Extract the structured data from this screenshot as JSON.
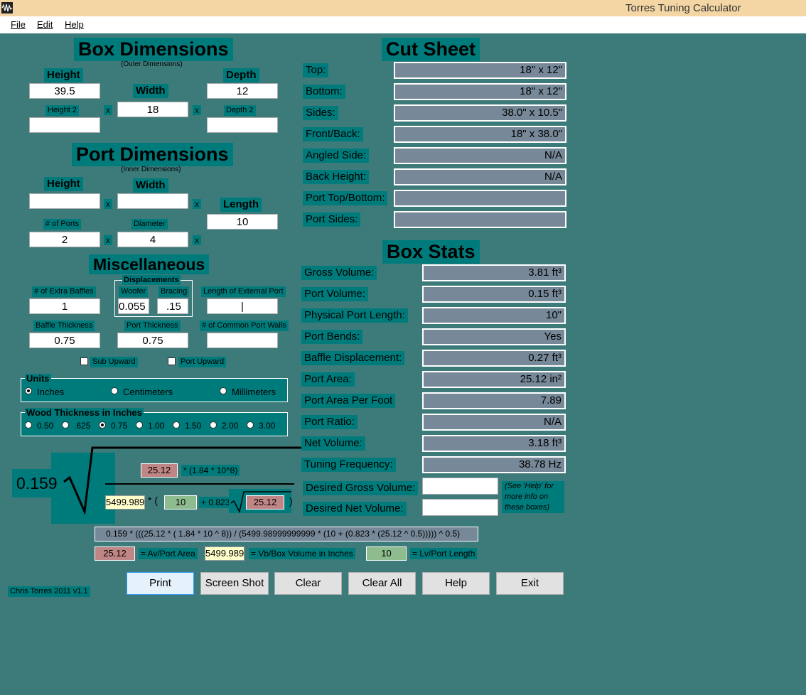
{
  "window": {
    "title": "Torres Tuning Calculator"
  },
  "menu": {
    "file": "File",
    "edit": "Edit",
    "help": "Help"
  },
  "box": {
    "title": "Box Dimensions",
    "subtitle": "(Outer Dimensions)",
    "height_label": "Height",
    "height_value": "39.5",
    "width_label": "Width",
    "width_value": "18",
    "depth_label": "Depth",
    "depth_value": "12",
    "height2_label": "Height 2",
    "height2_value": "",
    "depth2_label": "Depth 2",
    "depth2_value": ""
  },
  "port": {
    "title": "Port Dimensions",
    "subtitle": "(Inner Dimensions)",
    "height_label": "Height",
    "height_value": "",
    "width_label": "Width",
    "width_value": "",
    "length_label": "Length",
    "length_value": "10",
    "ports_label": "# of Ports",
    "ports_value": "2",
    "diameter_label": "Diameter",
    "diameter_value": "4"
  },
  "x_mark": "x",
  "misc": {
    "title": "Miscellaneous",
    "extra_baffles_label": "# of Extra Baffles",
    "extra_baffles_value": "1",
    "displacements_label": "Displacements",
    "woofer_label": "Woofer",
    "woofer_value": "0.055",
    "bracing_label": "Bracing",
    "bracing_value": ".15",
    "ext_port_label": "Length of External Port",
    "ext_port_value": "|",
    "baffle_thickness_label": "Baffle Thickness",
    "baffle_thickness_value": "0.75",
    "port_thickness_label": "Port Thickness",
    "port_thickness_value": "0.75",
    "common_walls_label": "# of Common Port Walls",
    "common_walls_value": "",
    "sub_upward": "Sub Upward",
    "port_upward": "Port Upward"
  },
  "units": {
    "title": "Units",
    "options": [
      "Inches",
      "Centimeters",
      "Millimeters"
    ],
    "selected": "Inches"
  },
  "wood": {
    "title": "Wood Thickness in Inches",
    "options": [
      "0.50",
      ".625",
      "0.75",
      "1.00",
      "1.50",
      "2.00",
      "3.00"
    ],
    "selected": "0.75"
  },
  "cut_sheet": {
    "title": "Cut Sheet",
    "rows": [
      {
        "label": "Top:",
        "value": "18\" x 12\""
      },
      {
        "label": "Bottom:",
        "value": "18\" x 12\""
      },
      {
        "label": "Sides:",
        "value": "38.0\" x 10.5\""
      },
      {
        "label": "Front/Back:",
        "value": "18\" x 38.0\""
      },
      {
        "label": "Angled Side:",
        "value": "N/A"
      },
      {
        "label": "Back Height:",
        "value": "N/A"
      },
      {
        "label": "Port Top/Bottom:",
        "value": ""
      },
      {
        "label": "Port Sides:",
        "value": ""
      }
    ]
  },
  "stats": {
    "title": "Box Stats",
    "rows": [
      {
        "label": "Gross Volume:",
        "value": "3.81 ft³"
      },
      {
        "label": "Port Volume:",
        "value": "0.15 ft³"
      },
      {
        "label": "Physical Port Length:",
        "value": "10\""
      },
      {
        "label": "Port Bends:",
        "value": "Yes"
      },
      {
        "label": "Baffle Displacement:",
        "value": "0.27 ft³"
      },
      {
        "label": "Port Area:",
        "value": "25.12 in²"
      },
      {
        "label": "Port Area Per Foot",
        "value": "7.89"
      },
      {
        "label": "Port Ratio:",
        "value": "N/A"
      },
      {
        "label": "Net Volume:",
        "value": "3.18 ft³"
      },
      {
        "label": "Tuning Frequency:",
        "value": "38.78 Hz"
      }
    ],
    "desired_gross_label": "Desired Gross Volume:",
    "desired_gross_value": "",
    "desired_net_label": "Desired Net Volume:",
    "desired_net_value": "",
    "help_note": "(See 'Help' for more info on these boxes)"
  },
  "formula": {
    "coef": "0.159",
    "av": "25.12",
    "mult": "* (1.84 * 10^8)",
    "vb": "5499.989",
    "open": "* (",
    "lv": "10",
    "plus": "+ 0.823",
    "close": ")",
    "expression": "0.159 * (((25.12 * ( 1.84 * 10 ^ 8)) / (5499.98999999999 * (10 + (0.823 * (25.12 ^ 0.5))))) ^ 0.5)",
    "legend_av": "= Av/Port Area",
    "legend_vb": "= Vb/Box Volume in Inches",
    "legend_lv": "= Lv/Port Length"
  },
  "footer": {
    "credit": "Chris Torres 2011 v1.1"
  },
  "buttons": [
    "Print",
    "Screen Shot",
    "Clear",
    "Clear All",
    "Help",
    "Exit"
  ]
}
